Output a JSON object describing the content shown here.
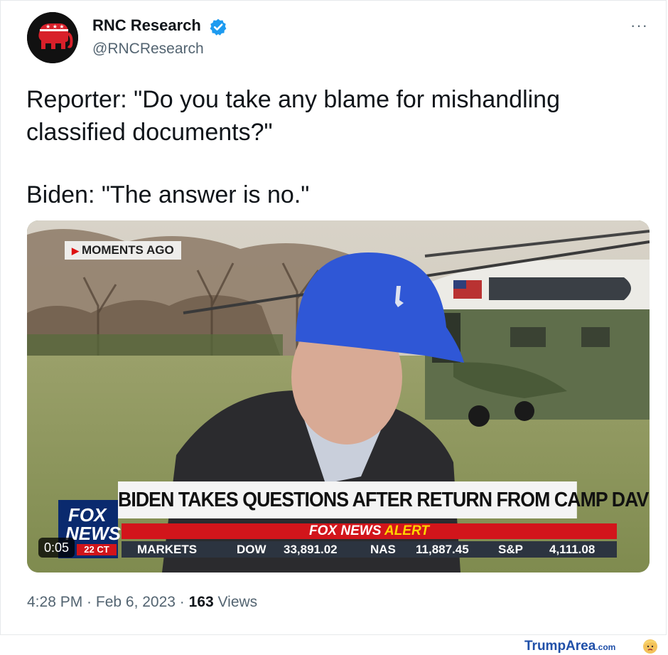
{
  "tweet": {
    "author_name": "RNC Research",
    "author_handle": "@RNCResearch",
    "more_label": "···",
    "text_line1": "Reporter: \"Do you take any blame for mishandling classified documents?\"",
    "text_line2": "Biden: \"The answer is no.\"",
    "timestamp": "4:28 PM · Feb 6, 2023 ·",
    "views_count": "163",
    "views_label": "Views"
  },
  "video": {
    "overlay_tag": "MOMENTS AGO",
    "chyron_headline": "BIDEN TAKES QUESTIONS AFTER RETURN FROM CAMP DAVID",
    "alert_fox": "FOX NEWS",
    "alert_word": "ALERT",
    "logo_line1": "FOX",
    "logo_line2": "NEWS",
    "logo_time": "22 CT",
    "ticker_markets": "MARKETS",
    "ticker_dow_label": "DOW",
    "ticker_dow_value": "33,891.02",
    "ticker_nas_label": "NAS",
    "ticker_nas_value": "11,887.45",
    "ticker_sp_label": "S&P",
    "ticker_sp_value": "4,111.08",
    "duration": "0:05"
  },
  "watermark": {
    "brand": "TrumpArea",
    "domain": ".com"
  },
  "colors": {
    "verified_blue": "#1d9bf0",
    "fox_red": "#d2151b",
    "fox_blue": "#0a2a6e",
    "watermark_blue": "#1f4fa8"
  },
  "icons": [
    "elephant-logo-icon",
    "verified-badge-icon",
    "more-icon",
    "fox-news-logo-icon",
    "trumparea-face-icon"
  ]
}
